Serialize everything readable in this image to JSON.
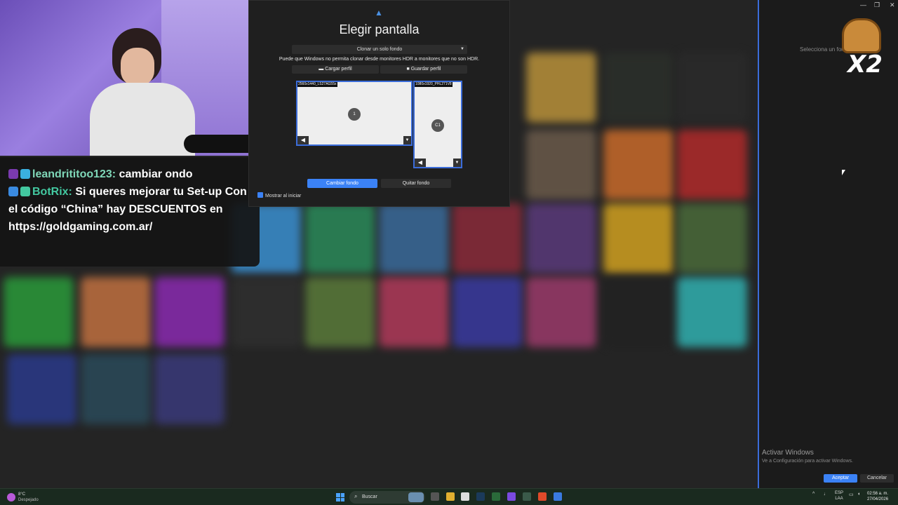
{
  "chat": {
    "lines": [
      {
        "user": "leandrititoo123:",
        "text": " cambiar ondo"
      },
      {
        "user": "BotRix:",
        "text": " Si queres mejorar tu Set-up Con el código “China” hay DESCUENTOS en https://goldgaming.com.ar/"
      }
    ]
  },
  "dialog": {
    "title": "Elegir pantalla",
    "clone_select": "Clonar un solo fondo",
    "hdr_note": "Puede que Windows no permita clonar desde monitores HDR a monitores que no son HDR.",
    "load_profile": "Cargar perfil",
    "save_profile": "Guardar perfil",
    "monitors": [
      {
        "label": "2560x1440_LS27AG55x",
        "number": "1"
      },
      {
        "label": "1080x1920_PHL271V8",
        "number": "C1"
      }
    ],
    "change_bg": "Cambiar fondo",
    "remove_bg": "Quitar fondo",
    "show_at_start": "Mostrar al iniciar"
  },
  "right_panel": {
    "hint": "Selecciona un fondo",
    "overlay": "X2",
    "activate_title": "Activar Windows",
    "activate_sub": "Ve a Configuración para activar Windows.",
    "accept": "Aceptar",
    "cancel": "Cancelar"
  },
  "taskbar": {
    "temp": "8°C",
    "weather": "Despejado",
    "search": "Buscar",
    "lang1": "ESP",
    "lang2": "LAA",
    "time": "02:56 a. m.",
    "date": "27/04/2026"
  },
  "colors": {
    "accent": "#3b82f6",
    "monitor_border": "#3b6cd9"
  }
}
